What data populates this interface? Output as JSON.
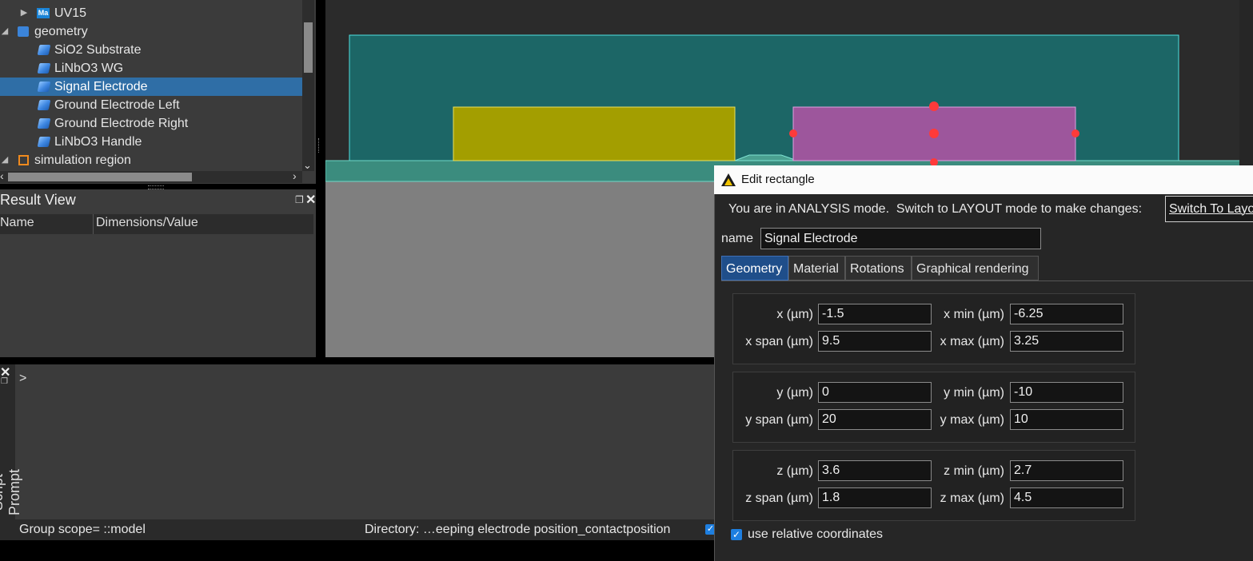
{
  "object_tree": {
    "items": [
      {
        "label": "UV15",
        "icon": "material-icon"
      },
      {
        "label": "geometry",
        "icon": "folder-icon"
      },
      {
        "label": "SiO2 Substrate",
        "icon": "rectangle-icon"
      },
      {
        "label": "LiNbO3 WG",
        "icon": "polygon-icon"
      },
      {
        "label": "Signal Electrode",
        "icon": "rectangle-icon"
      },
      {
        "label": "Ground Electrode Left",
        "icon": "rectangle-icon"
      },
      {
        "label": "Ground Electrode Right",
        "icon": "rectangle-icon"
      },
      {
        "label": "LiNbO3 Handle",
        "icon": "rectangle-icon"
      },
      {
        "label": "simulation region",
        "icon": "simulation-region-icon"
      }
    ],
    "ma_badge": "Ma"
  },
  "result_view": {
    "title": "Result View",
    "columns": [
      "Name",
      "Dimensions/Value"
    ]
  },
  "script_prompt": {
    "title": "Script Prompt",
    "prompt_symbol": ">",
    "scope": "Group scope= ::model",
    "directory": "Directory: …eeping electrode position_contactposition"
  },
  "dialog": {
    "title": "Edit rectangle",
    "mode_message": "You are in ANALYSIS mode.  Switch to LAYOUT mode to make changes:",
    "switch_button": "Switch To Layout",
    "name_label": "name",
    "name_value": "Signal Electrode",
    "tabs": [
      "Geometry",
      "Material",
      "Rotations",
      "Graphical rendering"
    ],
    "active_tab": "Geometry",
    "geometry": {
      "x": {
        "label": "x (µm)",
        "value": "-1.5"
      },
      "x_min": {
        "label": "x min (µm)",
        "value": "-6.25"
      },
      "x_span": {
        "label": "x span (µm)",
        "value": "9.5"
      },
      "x_max": {
        "label": "x max (µm)",
        "value": "3.25"
      },
      "y": {
        "label": "y (µm)",
        "value": "0"
      },
      "y_min": {
        "label": "y min (µm)",
        "value": "-10"
      },
      "y_span": {
        "label": "y span (µm)",
        "value": "20"
      },
      "y_max": {
        "label": "y max (µm)",
        "value": "10"
      },
      "z": {
        "label": "z (µm)",
        "value": "3.6"
      },
      "z_min": {
        "label": "z min (µm)",
        "value": "2.7"
      },
      "z_span": {
        "label": "z span (µm)",
        "value": "1.8"
      },
      "z_max": {
        "label": "z max (µm)",
        "value": "4.5"
      }
    },
    "use_relative_coordinates": {
      "label": "use relative coordinates",
      "checked": true
    }
  },
  "colors": {
    "selection": "#2f6ea6",
    "simulation_region": "#1c6666",
    "signal_electrode": "#9d569c",
    "ground_electrode": "#a39e00",
    "substrate": "#7f7f7f",
    "handle_marker": "#ff3a3a"
  }
}
